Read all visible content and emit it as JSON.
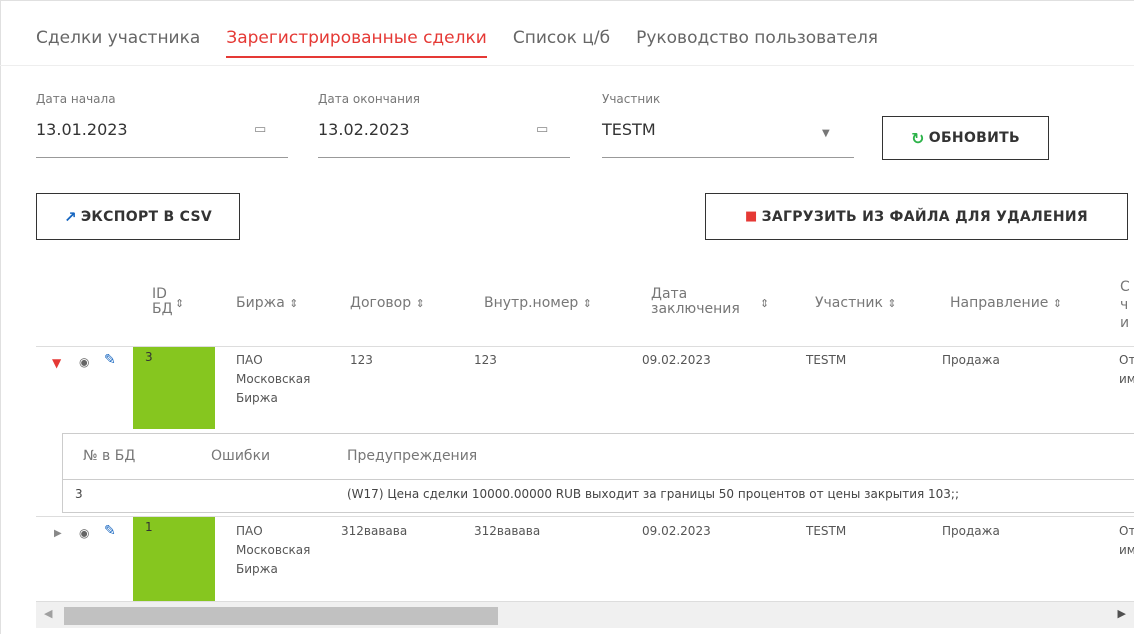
{
  "tabs": [
    "Сделки участника",
    "Зарегистрированные сделки",
    "Список ц/б",
    "Руководство пользователя"
  ],
  "filters": {
    "start_date": {
      "label": "Дата начала",
      "value": "13.01.2023"
    },
    "end_date": {
      "label": "Дата окончания",
      "value": "13.02.2023"
    },
    "participant": {
      "label": "Участник",
      "value": "TESTM"
    }
  },
  "buttons": {
    "refresh": "ОБНОВИТЬ",
    "export": "ЭКСПОРТ В CSV",
    "upload": "ЗАГРУЗИТЬ ИЗ ФАЙЛА ДЛЯ УДАЛЕНИЯ"
  },
  "table": {
    "headers": {
      "id_line1": "ID",
      "id_line2": "БД",
      "exchange": "Биржа",
      "contract": "Договор",
      "internal": "Внутр.номер",
      "date_line1": "Дата",
      "date_line2": "заключения",
      "participant": "Участник",
      "direction": "Направление",
      "cut_line1": "С",
      "cut_line2": "ч",
      "cut_line3": "и"
    },
    "sort_icon": "⇕",
    "rows": [
      {
        "id": "3",
        "exchange_l1": "ПАО",
        "exchange_l2": "Московская",
        "exchange_l3": "Биржа",
        "contract": "123",
        "internal": "123",
        "date": "09.02.2023",
        "participant": "TESTM",
        "direction": "Продажа",
        "cut_l1": "От",
        "cut_l2": "им"
      },
      {
        "id": "1",
        "exchange_l1": "ПАО",
        "exchange_l2": "Московская",
        "exchange_l3": "Биржа",
        "contract": "312вавава",
        "internal": "312вавава",
        "date": "09.02.2023",
        "participant": "TESTM",
        "direction": "Продажа",
        "cut_l1": "От",
        "cut_l2": "им"
      }
    ],
    "nested": {
      "headers": [
        "№ в БД",
        "Ошибки",
        "Предупреждения"
      ],
      "row": {
        "num": "3",
        "errors": "",
        "warnings": "(W17) Цена сделки 10000.00000 RUB выходит за границы 50 процентов от цены закрытия 103;;"
      }
    }
  }
}
